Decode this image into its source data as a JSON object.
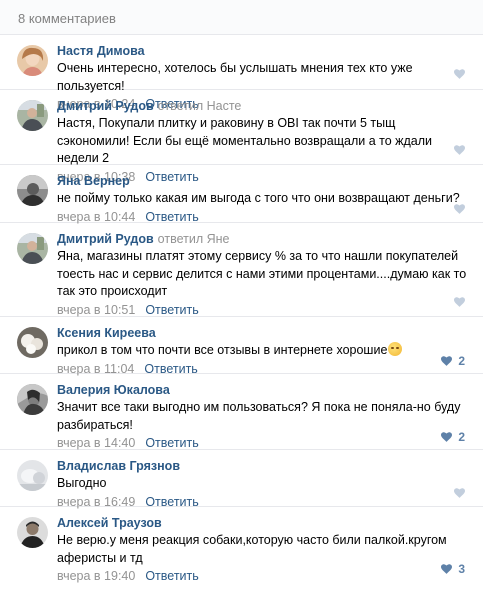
{
  "header": {
    "title": "8 комментариев"
  },
  "reply_label": "Ответить",
  "comments": [
    {
      "author": "Настя Димова",
      "reply_word": "",
      "reply_to": "",
      "text": "Очень интересно, хотелось бы услышать мнения тех кто уже пользуется!",
      "date": "вчера в 10:24",
      "likes": ""
    },
    {
      "author": "Дмитрий Рудов",
      "reply_word": "ответил",
      "reply_to": "Насте",
      "text": "Настя, Покупали плитку и раковину в OBI так почти 5 тыщ сэкономили! Если бы ещё моментально возвращали а то ждали недели 2",
      "date": "вчера в 10:38",
      "likes": ""
    },
    {
      "author": "Яна Вернер",
      "reply_word": "",
      "reply_to": "",
      "text": "не пойму только какая им выгода с того что они возвращают деньги?",
      "date": "вчера в 10:44",
      "likes": ""
    },
    {
      "author": "Дмитрий Рудов",
      "reply_word": "ответил",
      "reply_to": "Яне",
      "text": "Яна, магазины платят этому сервису % за то что нашли покупателей тоесть нас и сервис делится с нами этими процентами....думаю как то так это происходит",
      "date": "вчера в 10:51",
      "likes": ""
    },
    {
      "author": "Ксения Киреева",
      "reply_word": "",
      "reply_to": "",
      "text": "прикол в том что почти все отзывы в интернете хорошие",
      "date": "вчера в 11:04",
      "likes": "2"
    },
    {
      "author": "Валерия Юкалова",
      "reply_word": "",
      "reply_to": "",
      "text": "Значит все таки выгодно им пользоваться? Я пока не поняла-но буду разбираться!",
      "date": "вчера в 14:40",
      "likes": "2"
    },
    {
      "author": "Владислав Грязнов",
      "reply_word": "",
      "reply_to": "",
      "text": "Выгодно",
      "date": "вчера в 16:49",
      "likes": ""
    },
    {
      "author": "Алексей Траузов",
      "reply_word": "",
      "reply_to": "",
      "text": "Не верю.у меня реакция собаки,которую часто били палкой.кругом аферисты и тд",
      "date": "вчера в 19:40",
      "likes": "3"
    }
  ],
  "colors": {
    "link": "#2a5885",
    "muted": "#939393",
    "like": "#5e81a8",
    "divider": "#e7e8ec"
  }
}
